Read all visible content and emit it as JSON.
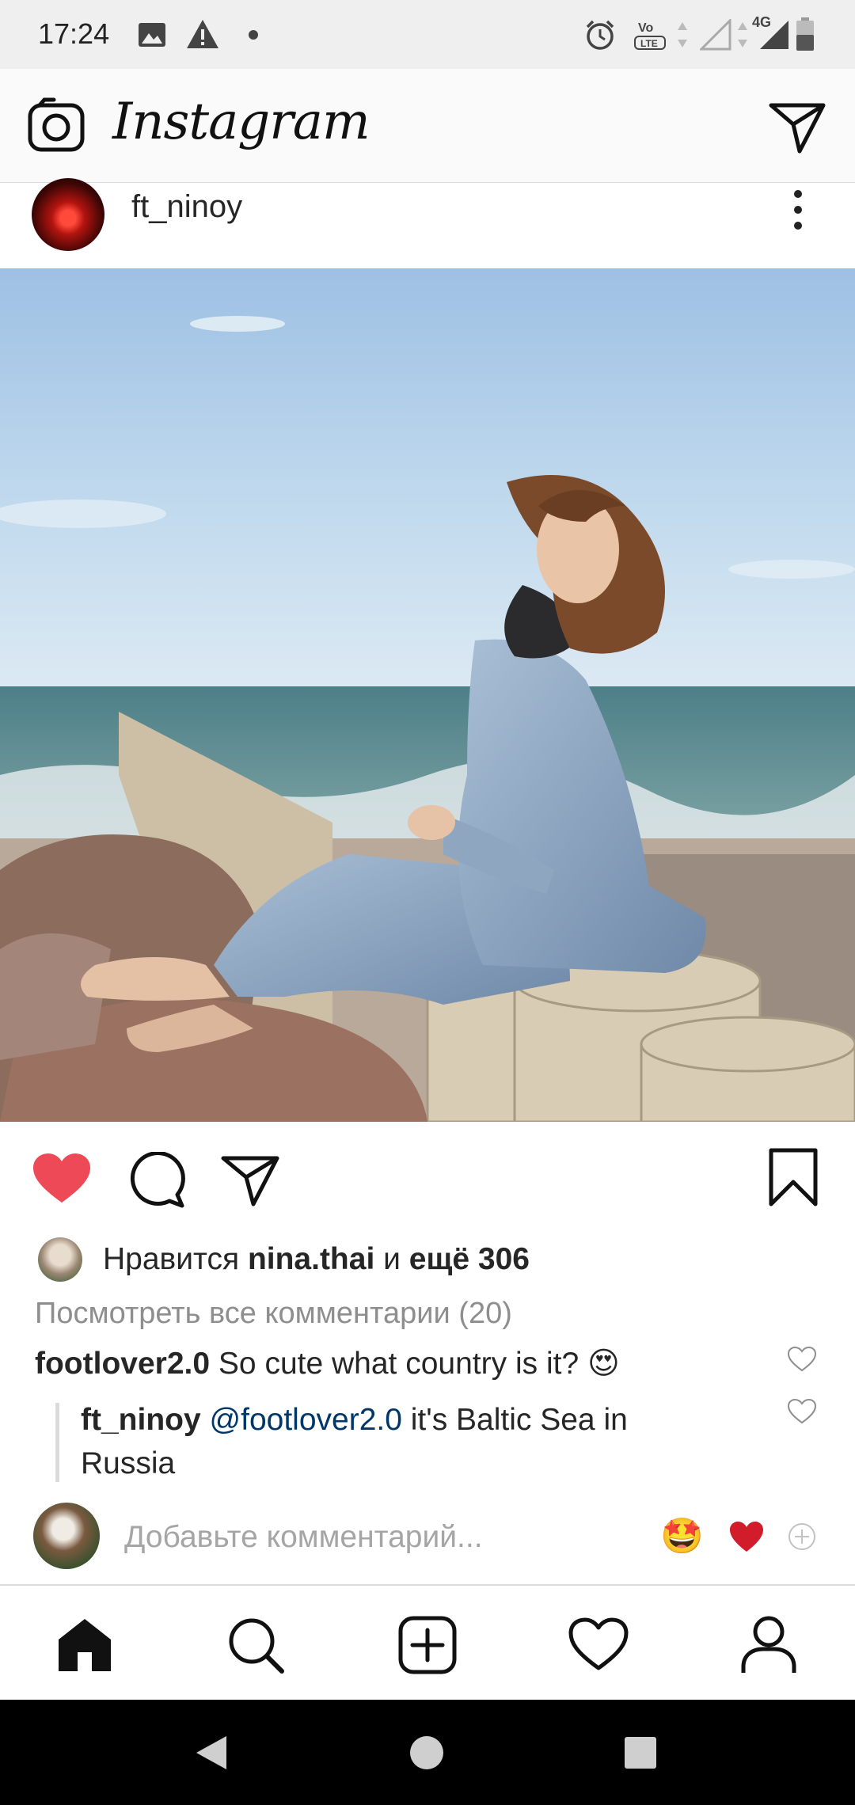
{
  "status_bar": {
    "time": "17:24",
    "network": "4G",
    "volte_label": "Vo LTE"
  },
  "header": {
    "app_name": "Instagram",
    "icons": [
      "camera-icon",
      "direct-message-icon"
    ]
  },
  "post": {
    "username": "ft_ninoy",
    "liked": true,
    "likes": {
      "prefix": "Нравится",
      "first_user": "nina.thai",
      "connector": "и",
      "others": "ещё 306"
    },
    "view_all_comments": "Посмотреть все комментарии (20)",
    "comments": [
      {
        "username": "footlover2.0",
        "text": "So cute what country is it? 😍"
      }
    ],
    "reply": {
      "username": "ft_ninoy",
      "mention": "@footlover2.0",
      "text": "it's Baltic Sea in Russia"
    },
    "add_comment_placeholder": "Добавьте комментарий...",
    "quick_reactions": [
      "🤩",
      "❤️"
    ]
  },
  "colors": {
    "like_red": "#ed4956",
    "text": "#262626",
    "muted": "#8e8e8e",
    "mention_blue": "#00376b"
  },
  "bottom_nav": [
    "home-icon",
    "search-icon",
    "new-post-icon",
    "activity-heart-icon",
    "profile-icon"
  ]
}
